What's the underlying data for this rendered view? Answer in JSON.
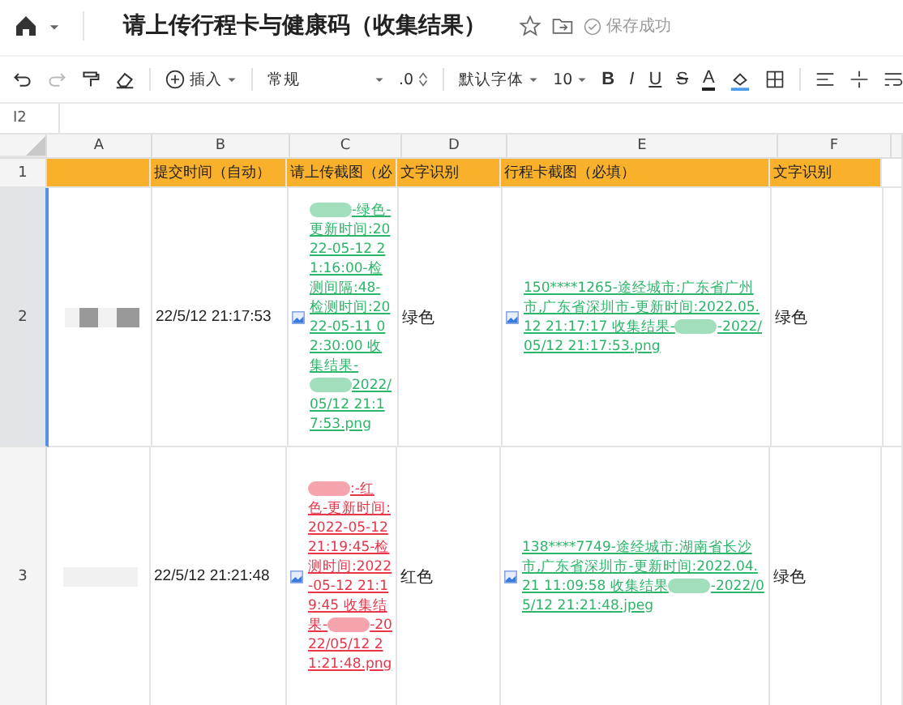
{
  "header": {
    "title": "请上传行程卡与健康码（收集结果）",
    "save_status": "保存成功"
  },
  "toolbar": {
    "insert": "插入",
    "number_format": "常规",
    "decimal": ".0",
    "font": "默认字体",
    "font_size": "10",
    "bold": "B",
    "italic": "I",
    "underline": "U",
    "strike": "S",
    "font_color": "A"
  },
  "formula_bar": {
    "cell_ref": "I2"
  },
  "sheet": {
    "columns": [
      "A",
      "B",
      "C",
      "D",
      "E",
      "F"
    ],
    "rows": [
      {
        "number": "1",
        "kind": "header",
        "cells": [
          "",
          "提交时间（自动）",
          "请上传截图（必",
          "文字识别",
          "行程卡截图（必填）",
          "文字识别"
        ]
      },
      {
        "number": "2",
        "kind": "data",
        "selected": true,
        "submitted": "22/5/12 21:17:53",
        "link_c": {
          "color": "#2db56a",
          "parts": [
            {
              "kind": "redaction"
            },
            {
              "kind": "text",
              "text": "-绿色-更新时间:2022-05-12 21:16:00-检测间隔:48-检测时间:2022-05-11 02:30:00 收集结果-"
            },
            {
              "kind": "redaction"
            },
            {
              "kind": "text",
              "text": "2022/05/12 21:17:53.png"
            }
          ]
        },
        "ocr_d": "绿色",
        "link_e": {
          "color": "#2db56a",
          "parts": [
            {
              "kind": "text",
              "text": "150****1265-途经城市:广东省广州市,广东省深圳市-更新时间:2022.05.12 21:17:17 收集结果-"
            },
            {
              "kind": "redaction"
            },
            {
              "kind": "text",
              "text": "-2022/05/12 21:17:53.png"
            }
          ]
        },
        "ocr_f": "绿色"
      },
      {
        "number": "3",
        "kind": "data",
        "selected": false,
        "submitted": "22/5/12 21:21:48",
        "link_c": {
          "color": "#e8354a",
          "parts": [
            {
              "kind": "redaction"
            },
            {
              "kind": "text",
              "text": ":-红色-更新时间:2022-05-12 21:19:45-检测时间:2022-05-12 21:19:45 收集结果-"
            },
            {
              "kind": "redaction"
            },
            {
              "kind": "text",
              "text": "-2022/05/12 21:21:48.png"
            }
          ]
        },
        "ocr_d": "红色",
        "link_e": {
          "color": "#2db56a",
          "parts": [
            {
              "kind": "text",
              "text": "138****7749-途经城市:湖南省长沙市,广东省深圳市-更新时间:2022.04.21 11:09:58 收集结果"
            },
            {
              "kind": "redaction"
            },
            {
              "kind": "text",
              "text": "-2022/05/12 21:21:48.jpeg"
            }
          ]
        },
        "ocr_f": "绿色"
      }
    ]
  }
}
